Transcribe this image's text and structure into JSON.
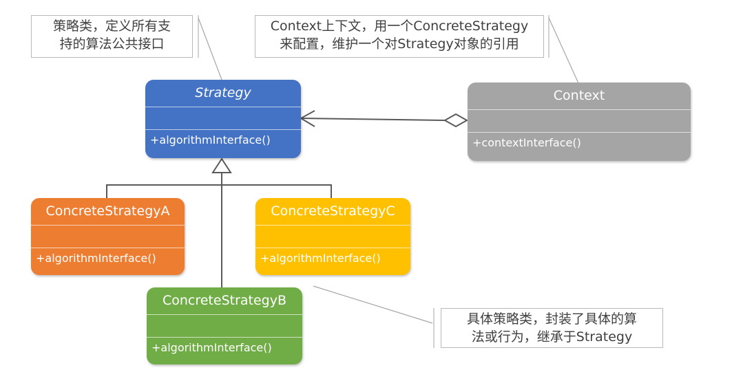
{
  "notes": {
    "strategy": {
      "lines": [
        "策略类，定义所有支",
        "持的算法公共接口"
      ]
    },
    "context": {
      "lines": [
        "Context上下文，用一个ConcreteStrategy",
        "来配置，维护一个对Strategy对象的引用"
      ]
    },
    "concrete": {
      "lines": [
        "具体策略类，封装了具体的算",
        "法或行为，继承于Strategy"
      ]
    }
  },
  "classes": {
    "strategy": {
      "name": "Strategy",
      "operation": "+algorithmInterface()",
      "color": "#4472c4"
    },
    "context": {
      "name": "Context",
      "operation": "+contextInterface()",
      "color": "#a5a5a5"
    },
    "concrete_a": {
      "name": "ConcreteStrategyA",
      "operation": "+algorithmInterface()",
      "color": "#ed7d31"
    },
    "concrete_c": {
      "name": "ConcreteStrategyC",
      "operation": "+algorithmInterface()",
      "color": "#ffc000"
    },
    "concrete_b": {
      "name": "ConcreteStrategyB",
      "operation": "+algorithmInterface()",
      "color": "#70ad47"
    }
  }
}
